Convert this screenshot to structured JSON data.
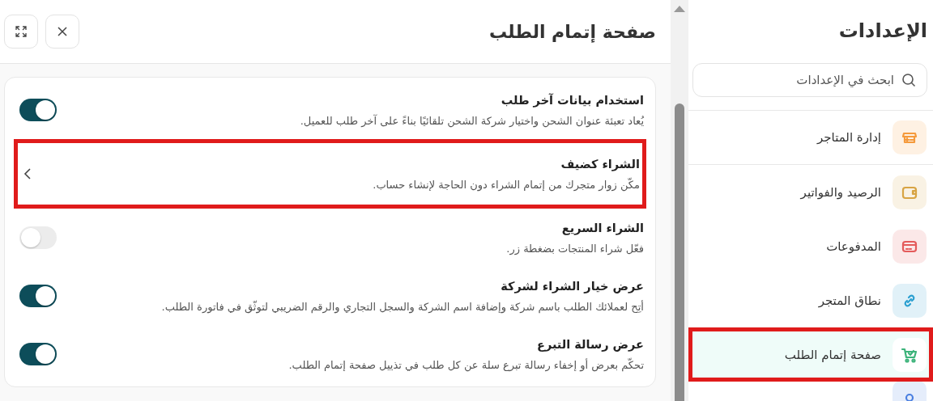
{
  "panel": {
    "title": "صفحة إتمام الطلب",
    "buttons": [
      {
        "kind": "expand"
      },
      {
        "kind": "close"
      }
    ]
  },
  "settings": [
    {
      "kind": "toggle",
      "title": "استخدام بيانات آخر طلب",
      "description": "يُعاد تعبئة عنوان الشحن واختيار شركة الشحن تلقائيًا بناءً على آخر طلب للعميل.",
      "on": true
    },
    {
      "kind": "link",
      "title": "الشراء كضيف",
      "description": "مكّن زوار متجرك من إتمام الشراء دون الحاجة لإنشاء حساب.",
      "highlighted": true
    },
    {
      "kind": "toggle",
      "title": "الشراء السريع",
      "description": "فعّل شراء المنتجات بضغطة زر.",
      "on": false
    },
    {
      "kind": "toggle",
      "title": "عرض خيار الشراء لشركة",
      "description": "أتِح لعملائك الطلب باسم شركة وإضافة اسم الشركة والسجل التجاري والرقم الضريبي لتوثّق في فاتورة الطلب.",
      "on": true
    },
    {
      "kind": "toggle",
      "title": "عرض رسالة التبرع",
      "description": "تحكّم بعرض أو إخفاء رسالة تبرع سلة عن كل طلب في تذييل صفحة إتمام الطلب.",
      "on": true
    }
  ],
  "sidebar": {
    "title": "الإعدادات",
    "search": {
      "placeholder": "ابحث في الإعدادات"
    },
    "items": [
      {
        "label": "إدارة المتاجر",
        "selected": false,
        "highlighted": false,
        "color": "#f59a3c"
      },
      {
        "label": "الرصيد والفواتير",
        "selected": false,
        "highlighted": false,
        "color": "#d8a443"
      },
      {
        "label": "المدفوعات",
        "selected": false,
        "highlighted": false,
        "color": "#e45b5b"
      },
      {
        "label": "نطاق المتجر",
        "selected": false,
        "highlighted": false,
        "color": "#2a9fd0"
      },
      {
        "label": "صفحة إتمام الطلب",
        "selected": true,
        "highlighted": true,
        "color": "#3cb37a"
      },
      {
        "selected": false,
        "highlighted": false,
        "color": "#4a7fe0"
      }
    ]
  }
}
